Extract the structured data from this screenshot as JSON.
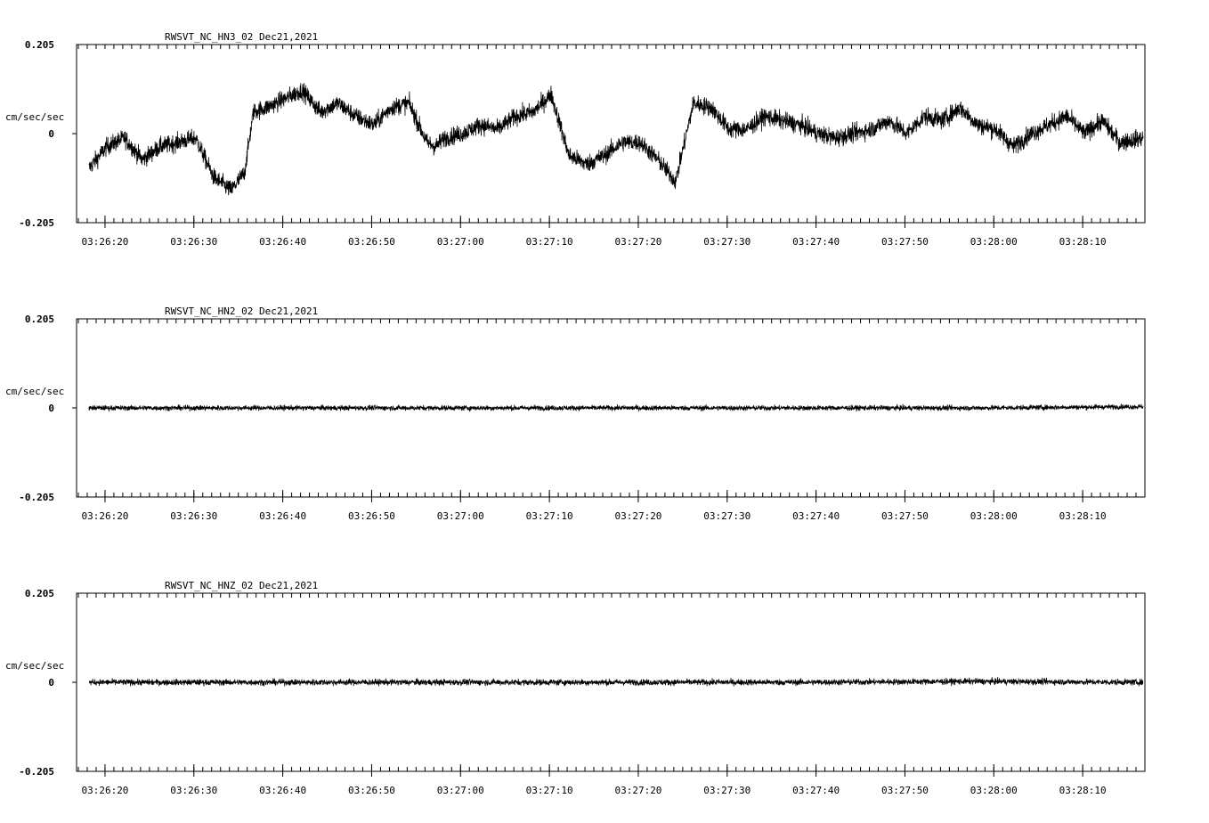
{
  "chart_data": [
    {
      "type": "line",
      "title": "RWSVT_NC_HN3_02  Dec21,2021",
      "ylabel": "cm/sec/sec",
      "ylim": [
        -0.205,
        0.205
      ],
      "y_ticks": [
        "0.205",
        "0",
        "-0.205"
      ],
      "x_ticks": [
        "03:26:20",
        "03:26:30",
        "03:26:40",
        "03:26:50",
        "03:27:00",
        "03:27:10",
        "03:27:20",
        "03:27:30",
        "03:27:40",
        "03:27:50",
        "03:28:00",
        "03:28:10"
      ],
      "xlim": [
        "03:26:16.8",
        "03:28:17.0"
      ],
      "data_start": "03:26:18.2",
      "series": [
        {
          "x_seconds_from_start": [
            0,
            2,
            4,
            6,
            8,
            10,
            12,
            14,
            16,
            17.5,
            18.5,
            20,
            22,
            24,
            26,
            28,
            30,
            32,
            34,
            36,
            38,
            39,
            40,
            42,
            44,
            46,
            48,
            50,
            52,
            54,
            56,
            58,
            60,
            62,
            64,
            66,
            68,
            70,
            72,
            74,
            76,
            78,
            80,
            82,
            84,
            86,
            88,
            90,
            92,
            94,
            96,
            98,
            100,
            102,
            104,
            106,
            108,
            110,
            112,
            114,
            116,
            118.6
          ],
          "values": [
            -0.08,
            -0.03,
            -0.01,
            -0.06,
            -0.03,
            -0.02,
            -0.01,
            -0.1,
            -0.13,
            -0.09,
            0.05,
            0.06,
            0.08,
            0.1,
            0.05,
            0.07,
            0.04,
            0.02,
            0.06,
            0.07,
            -0.02,
            -0.03,
            -0.01,
            0.0,
            0.02,
            0.01,
            0.04,
            0.05,
            0.09,
            -0.05,
            -0.07,
            -0.05,
            -0.02,
            -0.02,
            -0.06,
            -0.11,
            0.07,
            0.06,
            0.01,
            0.01,
            0.04,
            0.03,
            0.02,
            0.0,
            -0.01,
            0.0,
            0.01,
            0.03,
            0.0,
            0.04,
            0.03,
            0.06,
            0.02,
            0.01,
            -0.03,
            0.0,
            0.02,
            0.04,
            0.0,
            0.03,
            -0.02,
            -0.01
          ],
          "noise_amplitude": 0.035
        }
      ]
    },
    {
      "type": "line",
      "title": "RWSVT_NC_HN2_02  Dec21,2021",
      "ylabel": "cm/sec/sec",
      "ylim": [
        -0.205,
        0.205
      ],
      "y_ticks": [
        "0.205",
        "0",
        "-0.205"
      ],
      "x_ticks": [
        "03:26:20",
        "03:26:30",
        "03:26:40",
        "03:26:50",
        "03:27:00",
        "03:27:10",
        "03:27:20",
        "03:27:30",
        "03:27:40",
        "03:27:50",
        "03:28:00",
        "03:28:10"
      ],
      "xlim": [
        "03:26:16.8",
        "03:28:17.0"
      ],
      "data_start": "03:26:18.2",
      "series": [
        {
          "x_seconds_from_start": [
            0,
            20,
            40,
            60,
            80,
            100,
            118.6
          ],
          "values": [
            0.0,
            0.0,
            0.0,
            0.0,
            0.0,
            0.0,
            0.003
          ],
          "noise_amplitude": 0.01
        }
      ]
    },
    {
      "type": "line",
      "title": "RWSVT_NC_HNZ_02  Dec21,2021",
      "ylabel": "cm/sec/sec",
      "ylim": [
        -0.205,
        0.205
      ],
      "y_ticks": [
        "0.205",
        "0",
        "-0.205"
      ],
      "x_ticks": [
        "03:26:20",
        "03:26:30",
        "03:26:40",
        "03:26:50",
        "03:27:00",
        "03:27:10",
        "03:27:20",
        "03:27:30",
        "03:27:40",
        "03:27:50",
        "03:28:00",
        "03:28:10"
      ],
      "xlim": [
        "03:26:16.8",
        "03:28:17.0"
      ],
      "data_start": "03:26:18.2",
      "series": [
        {
          "x_seconds_from_start": [
            0,
            20,
            40,
            60,
            80,
            100,
            118.6
          ],
          "values": [
            0.0,
            0.0,
            0.0,
            0.0,
            0.0,
            0.002,
            0.0
          ],
          "noise_amplitude": 0.012
        }
      ]
    }
  ]
}
